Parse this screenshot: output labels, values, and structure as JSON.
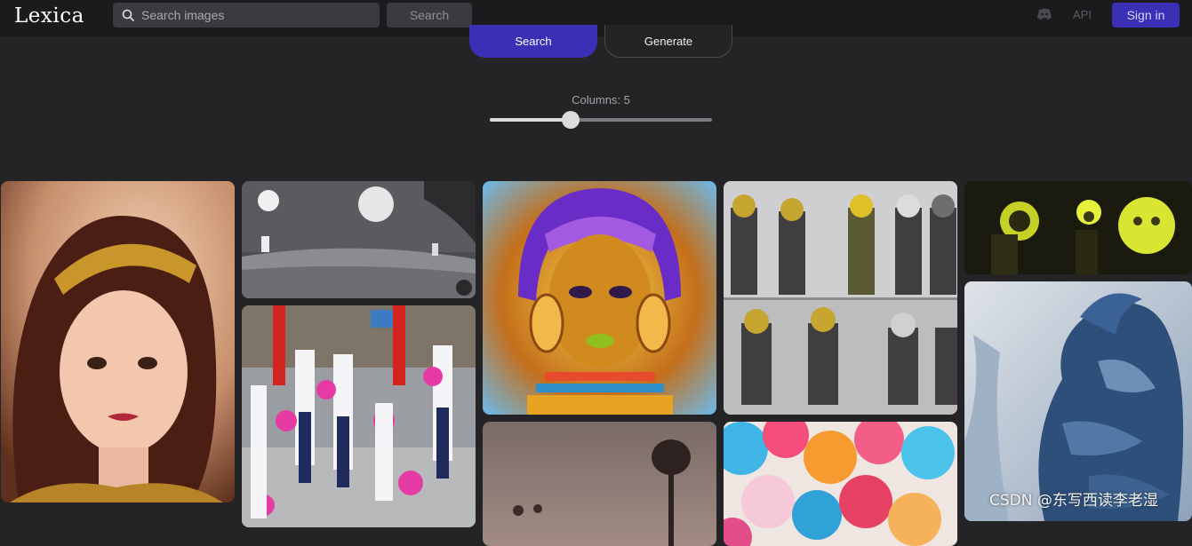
{
  "header": {
    "logo": "Lexica",
    "search_placeholder": "Search images",
    "search_button": "Search",
    "api_link": "API",
    "signin_button": "Sign in"
  },
  "mode_tabs": {
    "search": "Search",
    "generate": "Generate"
  },
  "columns_control": {
    "label": "Columns: 5",
    "value": 5,
    "slider_fraction": 0.36
  },
  "gallery": {
    "images": [
      {
        "subject": "princess-portrait"
      },
      {
        "subject": "moon-astronauts"
      },
      {
        "subject": "flower-parade"
      },
      {
        "subject": "golden-queen-portrait"
      },
      {
        "subject": "desert-figures"
      },
      {
        "subject": "astronaut-group-top"
      },
      {
        "subject": "astronaut-group-bottom"
      },
      {
        "subject": "paper-umbrellas"
      },
      {
        "subject": "neon-heads"
      },
      {
        "subject": "armored-knight"
      }
    ]
  },
  "watermark": "CSDN @东写西读李老湿",
  "colors": {
    "accent": "#3b2fb5",
    "background": "#242426",
    "topbar": "#1b1b1d"
  }
}
